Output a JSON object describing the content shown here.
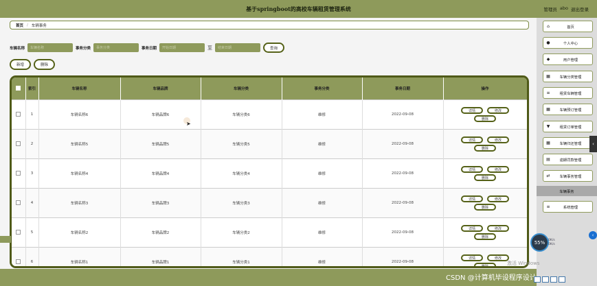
{
  "app": {
    "title": "基于springboot的高校车辆租赁管理系统",
    "user_role": "管理员",
    "user_name": "abo",
    "logout": "退出登录"
  },
  "breadcrumb": {
    "home": "首页",
    "separator": "/",
    "current": "车辆事务"
  },
  "search": {
    "name_label": "车辆名称",
    "name_placeholder": "车辆名称",
    "category_label": "事务分类",
    "category_placeholder": "事务分类",
    "date_label": "事务日期",
    "date_start_placeholder": "开始日期",
    "date_sep": "至",
    "date_end_placeholder": "结束日期",
    "query_button": "查询"
  },
  "actions": {
    "add": "新增",
    "delete": "删除"
  },
  "table": {
    "columns": [
      "索引",
      "车辆名称",
      "车辆品牌",
      "车辆分类",
      "事务分类",
      "事务日期",
      "操作"
    ],
    "rows": [
      {
        "index": "1",
        "name": "车辆名称6",
        "brand": "车辆品牌6",
        "category": "车辆分类6",
        "type": "维修",
        "date": "2022-09-08"
      },
      {
        "index": "2",
        "name": "车辆名称5",
        "brand": "车辆品牌5",
        "category": "车辆分类5",
        "type": "维修",
        "date": "2022-09-08"
      },
      {
        "index": "3",
        "name": "车辆名称4",
        "brand": "车辆品牌4",
        "category": "车辆分类4",
        "type": "维修",
        "date": "2022-09-08"
      },
      {
        "index": "4",
        "name": "车辆名称3",
        "brand": "车辆品牌3",
        "category": "车辆分类3",
        "type": "维修",
        "date": "2022-09-08"
      },
      {
        "index": "5",
        "name": "车辆名称2",
        "brand": "车辆品牌2",
        "category": "车辆分类2",
        "type": "维修",
        "date": "2022-09-08"
      },
      {
        "index": "6",
        "name": "车辆名称1",
        "brand": "车辆品牌1",
        "category": "车辆分类1",
        "type": "维修",
        "date": "2022-09-08"
      }
    ],
    "op_detail": "详情",
    "op_edit": "修改",
    "op_delete": "删除"
  },
  "sidebar": {
    "items": [
      {
        "label": "首页",
        "icon": "home-icon"
      },
      {
        "label": "个人中心",
        "icon": "person-icon"
      },
      {
        "label": "用户管理",
        "icon": "user-icon"
      },
      {
        "label": "车辆分类管理",
        "icon": "grid-icon"
      },
      {
        "label": "租赁车辆管理",
        "icon": "list-icon"
      },
      {
        "label": "车辆预订管理",
        "icon": "grid-icon"
      },
      {
        "label": "租赁订单管理",
        "icon": "shield-icon"
      },
      {
        "label": "车辆归还管理",
        "icon": "grid-icon"
      },
      {
        "label": "逾期罚款管理",
        "icon": "doc-icon"
      },
      {
        "label": "车辆事务管理",
        "icon": "toggle-icon"
      }
    ],
    "active_subitem": "车辆事务",
    "last_item": {
      "label": "系统管理",
      "icon": "list-icon"
    }
  },
  "overlay": {
    "speed_percent": "55%",
    "up_rate": "0K/s",
    "down_rate": "0K/s",
    "windows_watermark": "激活 Windows",
    "csdn_watermark": "CSDN @计算机毕设程序设计"
  },
  "colors": {
    "accent": "#8e9a5b",
    "border": "#556118"
  }
}
